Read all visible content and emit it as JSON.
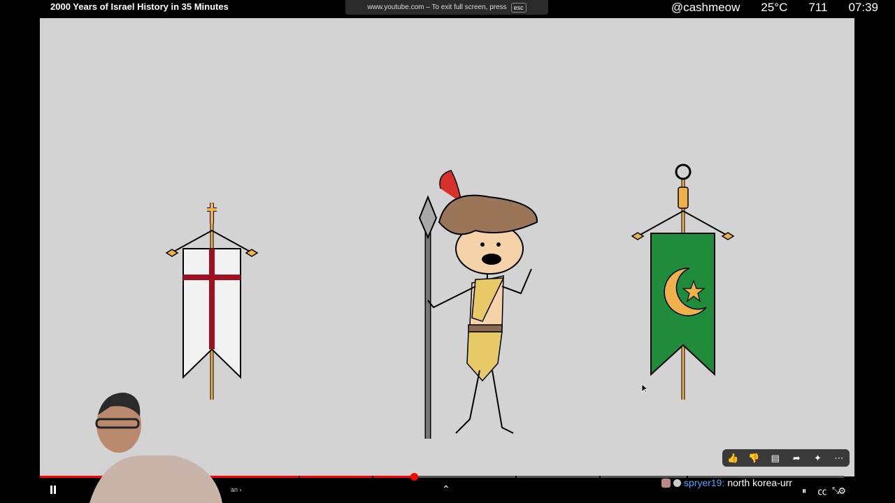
{
  "video": {
    "title": "2000 Years of Israel History in 35 Minutes",
    "progress_fraction": 0.465
  },
  "fullscreen_notice": {
    "text": "www.youtube.com – To exit full screen, press",
    "key": "esc"
  },
  "stream_overlay": {
    "handle": "@cashmeow",
    "temperature": "25°C",
    "count": "711",
    "clock": "07:39"
  },
  "chapter": {
    "label_fragment": "an",
    "chevron": "›"
  },
  "chat": {
    "username": "spryer19:",
    "message": "north korea-urr"
  },
  "reactions": [
    "thumbs-up-icon",
    "thumbs-down-icon",
    "comment-icon",
    "share-icon",
    "sparkle-icon",
    "more-icon"
  ],
  "controls": [
    "pause-icon",
    "cc-icon",
    "settings-icon",
    "exit-fullscreen-icon"
  ],
  "colors": {
    "stage_bg": "#d3d3d3",
    "crusader_cross": "#a01020",
    "islamic_banner": "#1e8c3a",
    "gold": "#f0b04a",
    "progress": "#ff0000",
    "chat_user": "#4aa3ff"
  }
}
